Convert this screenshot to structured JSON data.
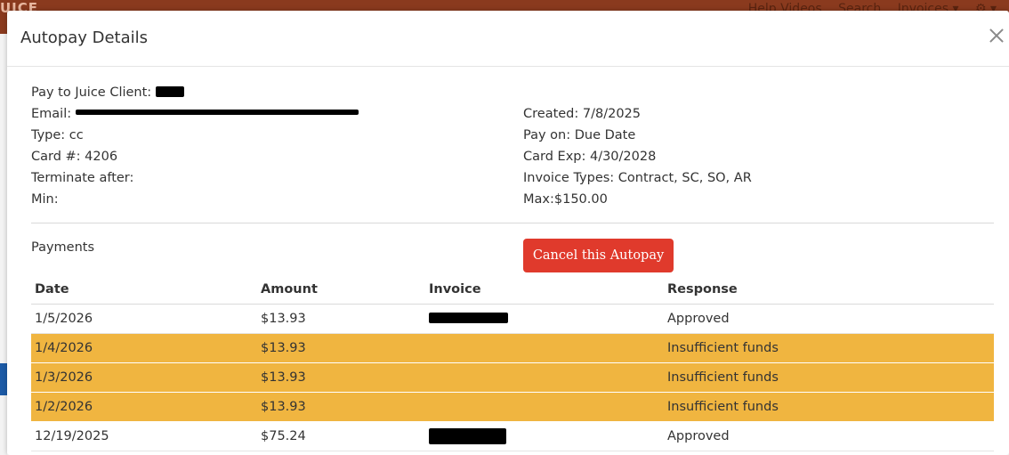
{
  "background": {
    "logo": "UICE",
    "nav": [
      "Help Videos",
      "Search",
      "Invoices ▾",
      "⚙ ▾"
    ]
  },
  "modal": {
    "title": "Autopay Details",
    "left_info": {
      "pay_to": "Pay to Juice Client:",
      "email": "Email:",
      "type": "Type: cc",
      "card": "Card #: 4206",
      "terminate": "Terminate after:",
      "min": "Min:"
    },
    "right_info": {
      "created": "Created: 7/8/2025",
      "pay_on": "Pay on: Due Date",
      "card_exp": "Card Exp: 4/30/2028",
      "invoice_types": "Invoice Types: Contract, SC, SO, AR",
      "max": "Max:$150.00"
    },
    "payments_label": "Payments",
    "cancel_button": "Cancel this Autopay",
    "table": {
      "headers": [
        "Date",
        "Amount",
        "Invoice",
        "Response"
      ],
      "rows": [
        {
          "date": "1/5/2026",
          "amount": "$13.93",
          "response": "Approved"
        },
        {
          "date": "1/4/2026",
          "amount": "$13.93",
          "response": "Insufficient funds"
        },
        {
          "date": "1/3/2026",
          "amount": "$13.93",
          "response": "Insufficient funds"
        },
        {
          "date": "1/2/2026",
          "amount": "$13.93",
          "response": "Insufficient funds"
        },
        {
          "date": "12/19/2025",
          "amount": "$75.24",
          "response": "Approved"
        }
      ]
    }
  },
  "colors": {
    "warning_row": "#f0b540",
    "cancel_button": "#e03a2c",
    "app_bar": "#8a3a1e"
  }
}
